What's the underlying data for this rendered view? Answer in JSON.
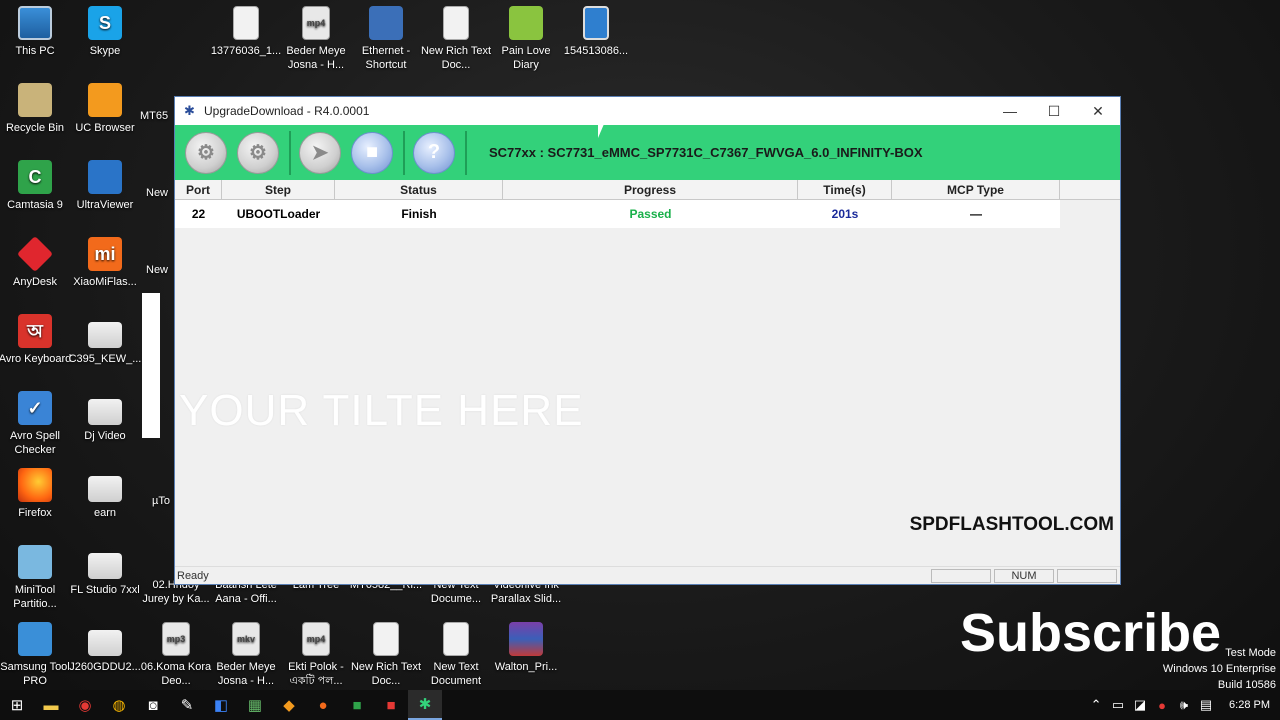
{
  "desktop": {
    "icons": [
      {
        "label": "This PC",
        "icon": "monitor-icon"
      },
      {
        "label": "Skype",
        "icon": "skype-icon"
      },
      {
        "label": "13776036_1...",
        "icon": "document-icon"
      },
      {
        "label": "Beder Meye Josna - H...",
        "icon": "mp4-icon"
      },
      {
        "label": "Ethernet - Shortcut",
        "icon": "network-icon"
      },
      {
        "label": "New Rich Text Doc...",
        "icon": "document-icon"
      },
      {
        "label": "Pain Love Diary",
        "icon": "android-icon"
      },
      {
        "label": "154513086...",
        "icon": "image-icon"
      },
      {
        "label": "Recycle Bin",
        "icon": "recycle-bin-icon"
      },
      {
        "label": "UC Browser",
        "icon": "uc-browser-icon"
      },
      {
        "label": "MT65",
        "icon": "folder-icon"
      },
      {
        "label": "Camtasia 9",
        "icon": "camtasia-icon"
      },
      {
        "label": "UltraViewer",
        "icon": "ultraviewer-icon"
      },
      {
        "label": "New",
        "icon": "document-icon"
      },
      {
        "label": "AnyDesk",
        "icon": "anydesk-icon"
      },
      {
        "label": "XiaoMiFlas...",
        "icon": "mi-icon"
      },
      {
        "label": "New",
        "icon": "document-icon"
      },
      {
        "label": "Avro Keyboard",
        "icon": "avro-icon"
      },
      {
        "label": "C395_KEW_...",
        "icon": "folder-icon"
      },
      {
        "label": "Avro Spell Checker",
        "icon": "spell-check-icon"
      },
      {
        "label": "Dj Video",
        "icon": "folder-icon"
      },
      {
        "label": "Firefox",
        "icon": "firefox-icon"
      },
      {
        "label": "earn",
        "icon": "folder-icon"
      },
      {
        "label": "µTo",
        "icon": "utorrent-icon"
      },
      {
        "label": "MiniTool Partitio...",
        "icon": "minitool-icon"
      },
      {
        "label": "FL Studio 7xxl",
        "icon": "folder-icon"
      },
      {
        "label": "02.Hridoy Jurey by Ka...",
        "icon": "mp3-icon"
      },
      {
        "label": "Baarish Lete Aana - Offi...",
        "icon": "mp4-icon"
      },
      {
        "label": "Lam Tree",
        "icon": "document-icon"
      },
      {
        "label": "MT6582__Ri...",
        "icon": "folder-icon"
      },
      {
        "label": "New Text Docume...",
        "icon": "document-icon"
      },
      {
        "label": "Videohive Ink Parallax Slid...",
        "icon": "document-icon"
      },
      {
        "label": "Samsung Tool PRO",
        "icon": "samsung-tool-icon"
      },
      {
        "label": "J260GDDU2...",
        "icon": "folder-icon"
      },
      {
        "label": "06.Koma Kora Deo...",
        "icon": "mp3-icon"
      },
      {
        "label": "Beder Meye Josna - H...",
        "icon": "mp4-icon"
      },
      {
        "label": "Ekti Polok - একটি পল...",
        "icon": "mp4-icon"
      },
      {
        "label": "New Rich Text Doc...",
        "icon": "document-icon"
      },
      {
        "label": "New Text Document",
        "icon": "text-document-icon"
      },
      {
        "label": "Walton_Pri...",
        "icon": "winrar-icon"
      }
    ]
  },
  "window": {
    "title": "UpgradeDownload - R4.0.0001",
    "model": "SC77xx : SC7731_eMMC_SP7731C_C7367_FWVGA_6.0_INFINITY-BOX",
    "toolbar_buttons": [
      {
        "name": "load-packet-button",
        "icon": "gear-icon",
        "glyph": "⚙"
      },
      {
        "name": "settings-button",
        "icon": "gears-icon",
        "glyph": "⚙"
      },
      {
        "name": "start-button",
        "icon": "play-icon",
        "glyph": "➤"
      },
      {
        "name": "stop-button",
        "icon": "stop-icon",
        "glyph": "■"
      },
      {
        "name": "help-button",
        "icon": "help-icon",
        "glyph": "?"
      }
    ],
    "columns": [
      "Port",
      "Step",
      "Status",
      "Progress",
      "Time(s)",
      "MCP Type"
    ],
    "rows": [
      {
        "port": "22",
        "step": "UBOOTLoader",
        "status": "Finish",
        "progress": "Passed",
        "time": "201s",
        "mcp_type": "—"
      }
    ],
    "watermark": "YOUR TILTE HERE",
    "site": "SPDFLASHTOOL.COM",
    "statusbar": {
      "ready": "Ready",
      "num": "NUM"
    }
  },
  "overlay": {
    "subscribe": "Subscribe",
    "win_line1": "Test Mode",
    "win_line2": "Windows 10 Enterprise",
    "win_line3": "Build 10586"
  },
  "taskbar": {
    "clock": "6:28 PM",
    "colors": {
      "accent": "#33d17a",
      "passed": "#19b04a",
      "time": "#1a2a9a"
    }
  }
}
